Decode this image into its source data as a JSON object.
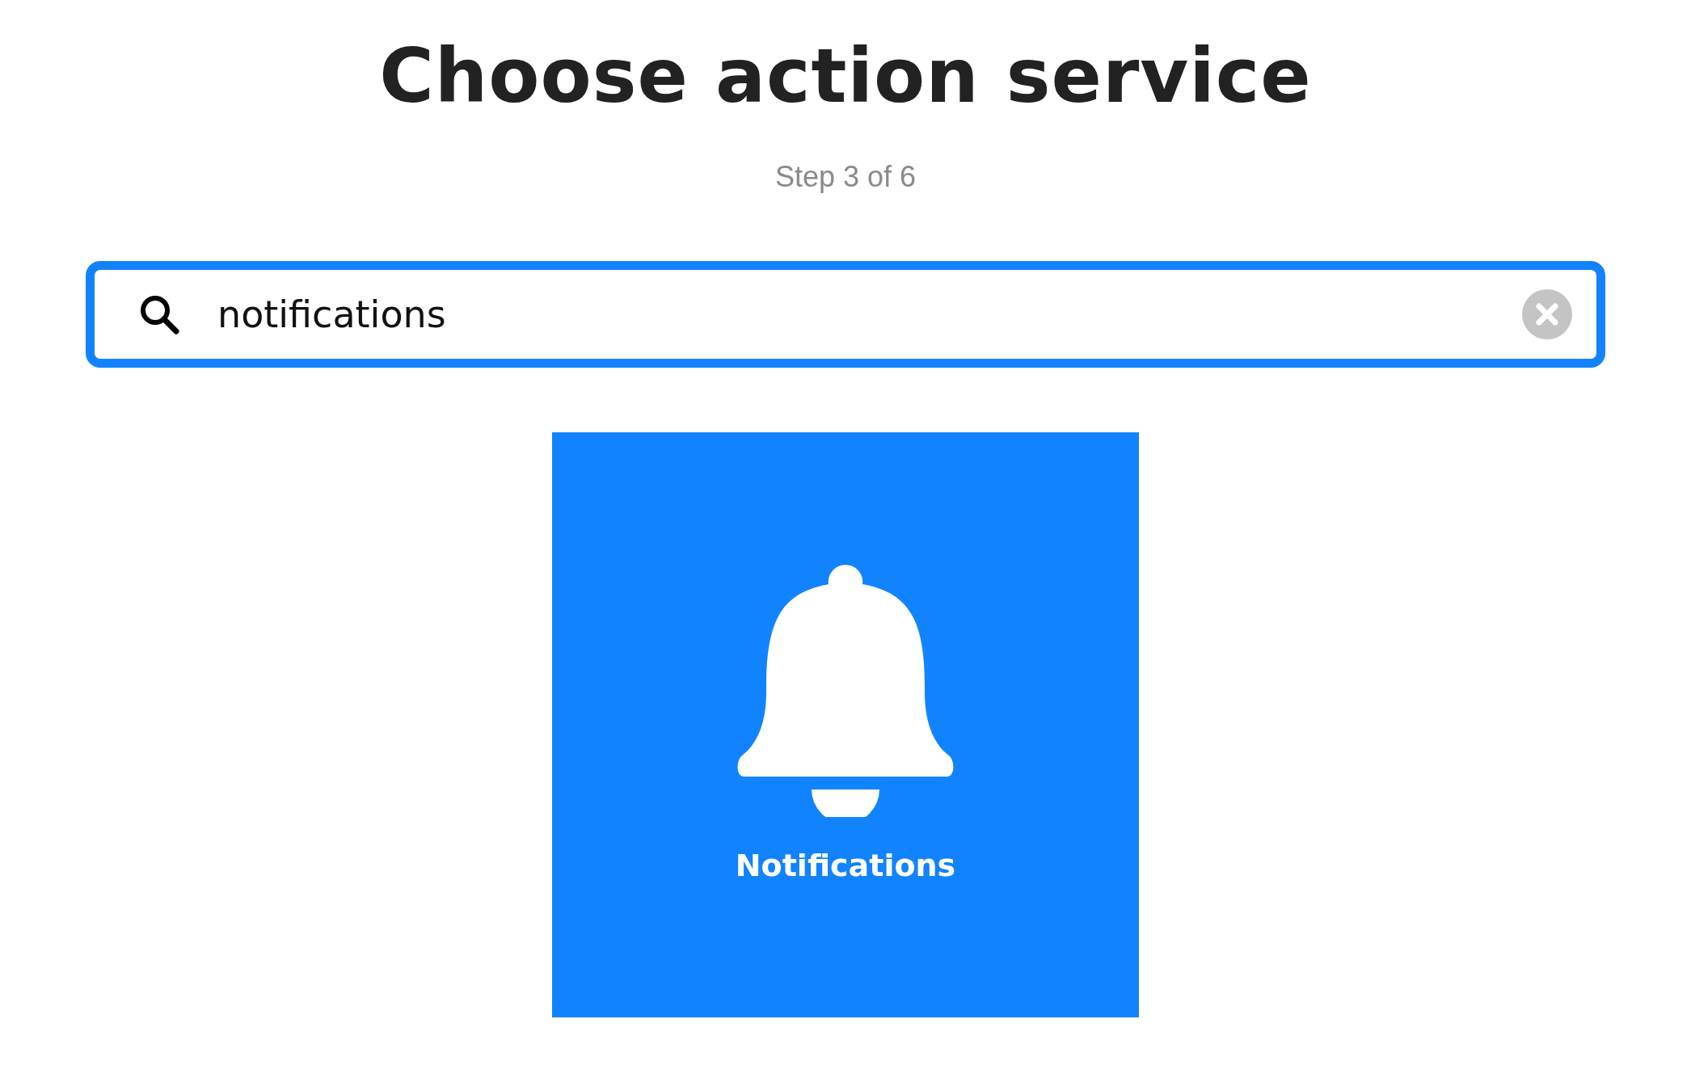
{
  "title": "Choose action service",
  "step": "Step 3 of 6",
  "search": {
    "value": "notifications"
  },
  "services": [
    {
      "name": "Notifications"
    }
  ]
}
